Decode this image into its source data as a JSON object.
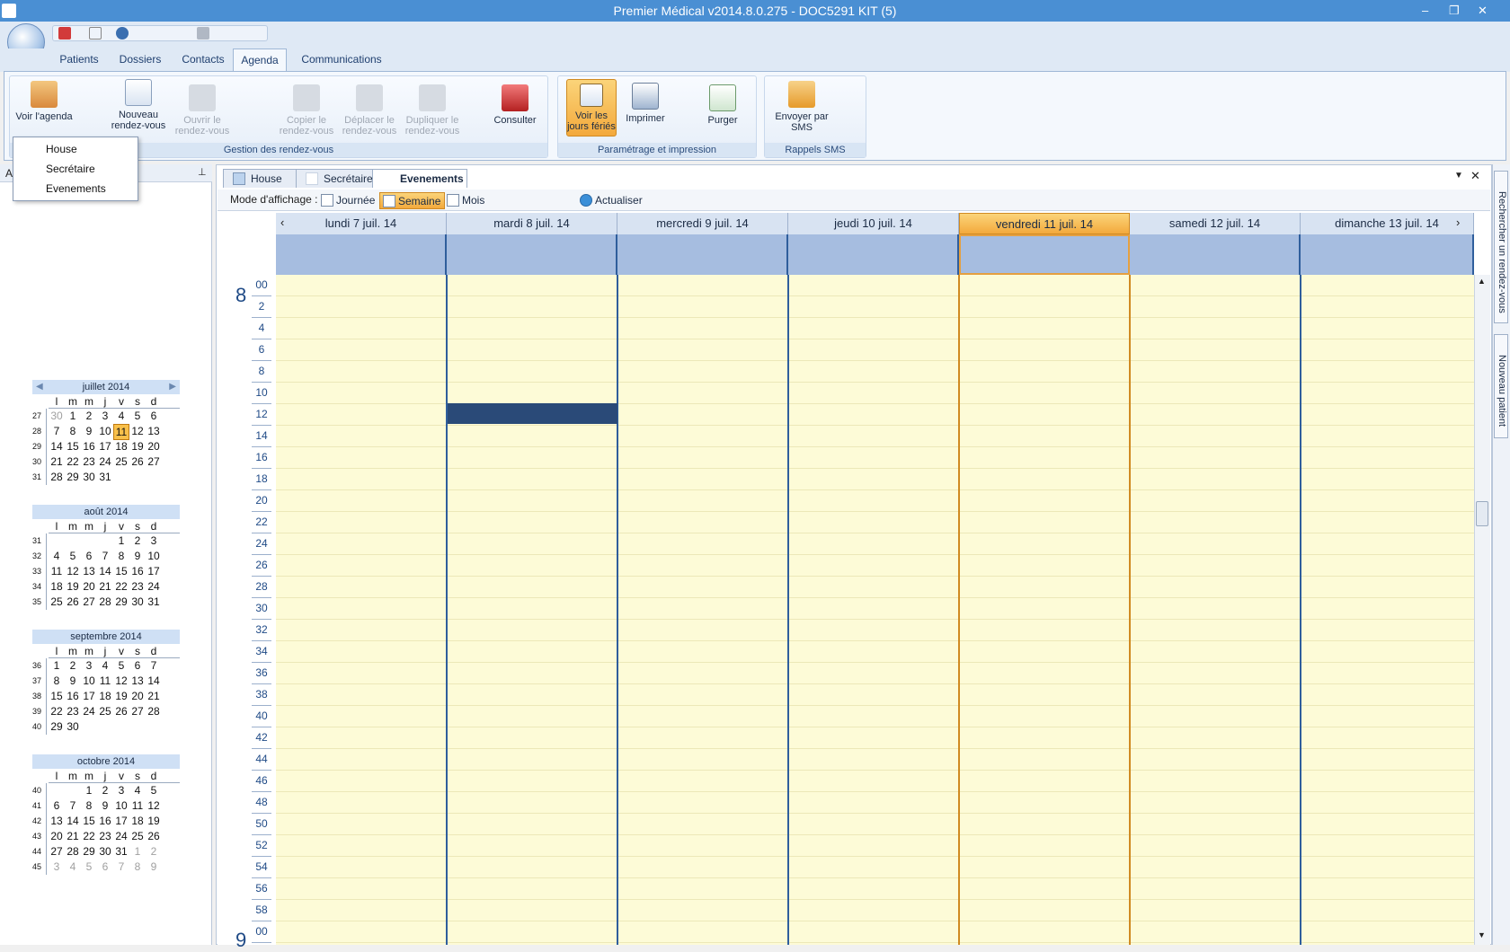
{
  "window": {
    "title": "Premier Médical v2014.8.0.275 - DOC5291 KIT (5)"
  },
  "ribbon_tabs": [
    "Patients",
    "Dossiers",
    "Contacts",
    "Agenda",
    "Communications"
  ],
  "ribbon": {
    "groups": [
      "Gestion des rendez-vous",
      "Paramétrage et impression",
      "Rappels SMS"
    ],
    "buttons": {
      "voir_agenda": "Voir l'agenda",
      "nouveau_rdv": "Nouveau rendez-vous",
      "ouvrir_rdv": "Ouvrir le rendez-vous",
      "copier_rdv": "Copier le rendez-vous",
      "deplacer_rdv": "Déplacer le rendez-vous",
      "dupliquer_rdv": "Dupliquer le rendez-vous",
      "consulter": "Consulter",
      "voir_feries": "Voir les jours fériés",
      "imprimer": "Imprimer",
      "purger": "Purger",
      "envoyer_sms": "Envoyer par SMS"
    }
  },
  "dropdown": {
    "items": [
      "House",
      "Secrétaire",
      "Evenements"
    ]
  },
  "left_panel": {
    "header_letter": "A"
  },
  "mini_calendars": [
    {
      "title": "juillet 2014",
      "days": [
        "l",
        "m",
        "m",
        "j",
        "v",
        "s",
        "d"
      ],
      "weeks": [
        {
          "wk": "27",
          "cells": [
            "30",
            "1",
            "2",
            "3",
            "4",
            "5",
            "6"
          ],
          "grey": [
            0
          ]
        },
        {
          "wk": "28",
          "cells": [
            "7",
            "8",
            "9",
            "10",
            "11",
            "12",
            "13"
          ],
          "grey": [],
          "today": 4
        },
        {
          "wk": "29",
          "cells": [
            "14",
            "15",
            "16",
            "17",
            "18",
            "19",
            "20"
          ],
          "grey": []
        },
        {
          "wk": "30",
          "cells": [
            "21",
            "22",
            "23",
            "24",
            "25",
            "26",
            "27"
          ],
          "grey": []
        },
        {
          "wk": "31",
          "cells": [
            "28",
            "29",
            "30",
            "31",
            "",
            "",
            ""
          ],
          "grey": []
        }
      ]
    },
    {
      "title": "août 2014",
      "days": [
        "l",
        "m",
        "m",
        "j",
        "v",
        "s",
        "d"
      ],
      "weeks": [
        {
          "wk": "31",
          "cells": [
            "",
            "",
            "",
            "",
            "1",
            "2",
            "3"
          ],
          "grey": []
        },
        {
          "wk": "32",
          "cells": [
            "4",
            "5",
            "6",
            "7",
            "8",
            "9",
            "10"
          ],
          "grey": []
        },
        {
          "wk": "33",
          "cells": [
            "11",
            "12",
            "13",
            "14",
            "15",
            "16",
            "17"
          ],
          "grey": []
        },
        {
          "wk": "34",
          "cells": [
            "18",
            "19",
            "20",
            "21",
            "22",
            "23",
            "24"
          ],
          "grey": []
        },
        {
          "wk": "35",
          "cells": [
            "25",
            "26",
            "27",
            "28",
            "29",
            "30",
            "31"
          ],
          "grey": []
        }
      ]
    },
    {
      "title": "septembre 2014",
      "days": [
        "l",
        "m",
        "m",
        "j",
        "v",
        "s",
        "d"
      ],
      "weeks": [
        {
          "wk": "36",
          "cells": [
            "1",
            "2",
            "3",
            "4",
            "5",
            "6",
            "7"
          ],
          "grey": []
        },
        {
          "wk": "37",
          "cells": [
            "8",
            "9",
            "10",
            "11",
            "12",
            "13",
            "14"
          ],
          "grey": []
        },
        {
          "wk": "38",
          "cells": [
            "15",
            "16",
            "17",
            "18",
            "19",
            "20",
            "21"
          ],
          "grey": []
        },
        {
          "wk": "39",
          "cells": [
            "22",
            "23",
            "24",
            "25",
            "26",
            "27",
            "28"
          ],
          "grey": []
        },
        {
          "wk": "40",
          "cells": [
            "29",
            "30",
            "",
            "",
            "",
            "",
            ""
          ],
          "grey": []
        }
      ]
    },
    {
      "title": "octobre 2014",
      "days": [
        "l",
        "m",
        "m",
        "j",
        "v",
        "s",
        "d"
      ],
      "weeks": [
        {
          "wk": "40",
          "cells": [
            "",
            "",
            "1",
            "2",
            "3",
            "4",
            "5"
          ],
          "grey": []
        },
        {
          "wk": "41",
          "cells": [
            "6",
            "7",
            "8",
            "9",
            "10",
            "11",
            "12"
          ],
          "grey": []
        },
        {
          "wk": "42",
          "cells": [
            "13",
            "14",
            "15",
            "16",
            "17",
            "18",
            "19"
          ],
          "grey": []
        },
        {
          "wk": "43",
          "cells": [
            "20",
            "21",
            "22",
            "23",
            "24",
            "25",
            "26"
          ],
          "grey": []
        },
        {
          "wk": "44",
          "cells": [
            "27",
            "28",
            "29",
            "30",
            "31",
            "1",
            "2"
          ],
          "grey": [
            5,
            6
          ]
        },
        {
          "wk": "45",
          "cells": [
            "3",
            "4",
            "5",
            "6",
            "7",
            "8",
            "9"
          ],
          "grey": [
            0,
            1,
            2,
            3,
            4,
            5,
            6
          ]
        }
      ]
    }
  ],
  "calendar_tabs": [
    "House",
    "Secrétaire",
    "Evenements"
  ],
  "toolbar": {
    "mode_label": "Mode d'affichage :",
    "journee": "Journée",
    "semaine": "Semaine",
    "mois": "Mois",
    "actualiser": "Actualiser"
  },
  "week_days": [
    "lundi 7  juil. 14",
    "mardi 8  juil. 14",
    "mercredi 9  juil. 14",
    "jeudi 10  juil. 14",
    "vendredi 11  juil. 14",
    "samedi 12  juil. 14",
    "dimanche 13  juil. 14"
  ],
  "time": {
    "hour_labels": [
      "8",
      "9"
    ],
    "minutes": [
      "00",
      "2",
      "4",
      "6",
      "8",
      "10",
      "12",
      "14",
      "16",
      "18",
      "20",
      "22",
      "24",
      "26",
      "28",
      "30",
      "32",
      "34",
      "36",
      "38",
      "40",
      "42",
      "44",
      "46",
      "48",
      "50",
      "52",
      "54",
      "56",
      "58",
      "00"
    ]
  },
  "side_tabs": [
    "Rechercher un rendez-vous",
    "Nouveau patient"
  ],
  "colors": {
    "accent": "#4a8fd3",
    "today": "#f3a93c",
    "grid": "#fdfbd7",
    "appointment": "#2a4a78"
  }
}
